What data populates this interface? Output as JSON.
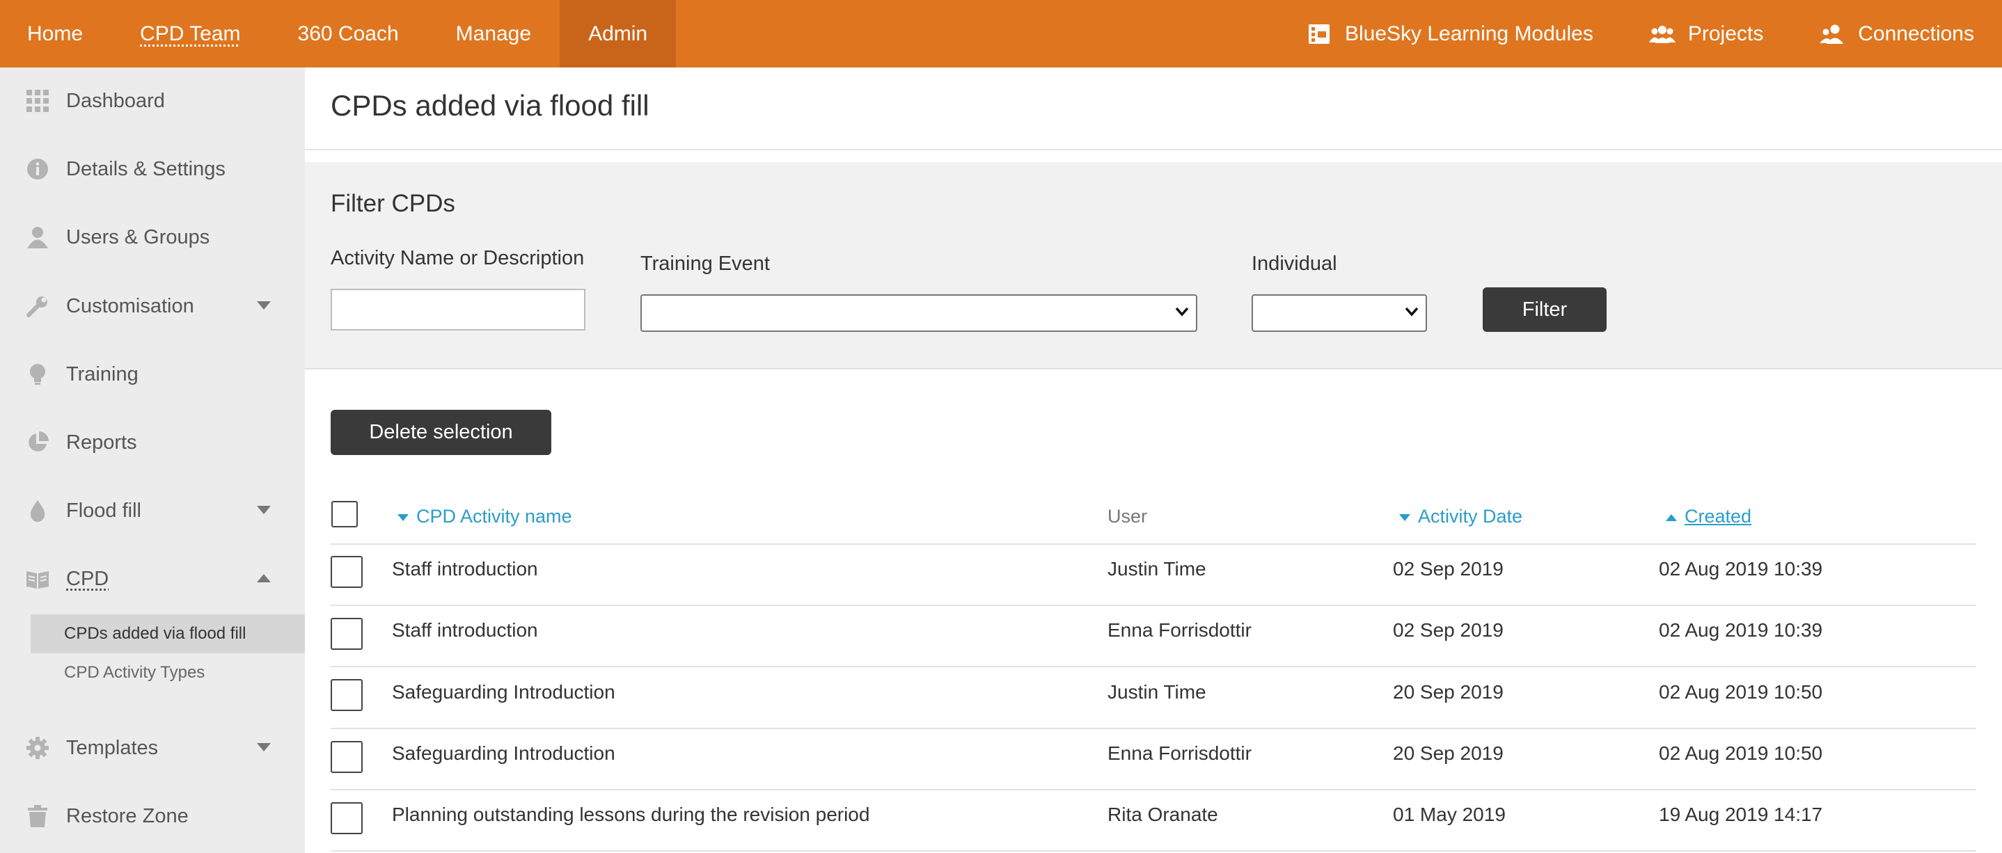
{
  "topnav": {
    "items": [
      "Home",
      "CPD Team",
      "360 Coach",
      "Manage",
      "Admin"
    ],
    "active": "Admin",
    "right_items": [
      "BlueSky Learning Modules",
      "Projects",
      "Connections"
    ],
    "accent_color": "#df761f"
  },
  "sidebar": {
    "items": [
      {
        "label": "Dashboard",
        "icon": "grid-icon"
      },
      {
        "label": "Details & Settings",
        "icon": "info-icon"
      },
      {
        "label": "Users & Groups",
        "icon": "user-icon"
      },
      {
        "label": "Customisation",
        "icon": "wrench-icon",
        "expandable": true
      },
      {
        "label": "Training",
        "icon": "lightbulb-icon"
      },
      {
        "label": "Reports",
        "icon": "pie-chart-icon"
      },
      {
        "label": "Flood fill",
        "icon": "drop-icon",
        "expandable": true
      },
      {
        "label": "CPD",
        "icon": "book-icon",
        "expanded": true
      },
      {
        "label": "Templates",
        "icon": "gear-icon",
        "expandable": true
      },
      {
        "label": "Restore Zone",
        "icon": "trash-icon"
      }
    ],
    "sub_items": [
      "CPDs added via flood fill",
      "CPD Activity Types"
    ],
    "active_sub": "CPDs added via flood fill"
  },
  "page": {
    "title": "CPDs added via flood fill"
  },
  "filter": {
    "title": "Filter CPDs",
    "activity_label": "Activity Name or Description",
    "activity_value": "",
    "training_label": "Training Event",
    "training_value": "",
    "individual_label": "Individual",
    "individual_value": "",
    "button": "Filter"
  },
  "actions": {
    "delete_button": "Delete selection"
  },
  "table": {
    "columns": [
      "CPD Activity name",
      "User",
      "Activity Date",
      "Created"
    ],
    "sort": {
      "CPD Activity name": "desc",
      "Activity Date": "desc",
      "Created": "asc"
    },
    "rows": [
      {
        "name": "Staff introduction",
        "user": "Justin Time",
        "date": "02 Sep 2019",
        "created": "02 Aug 2019 10:39"
      },
      {
        "name": "Staff introduction",
        "user": "Enna Forrisdottir",
        "date": "02 Sep 2019",
        "created": "02 Aug 2019 10:39"
      },
      {
        "name": "Safeguarding Introduction",
        "user": "Justin Time",
        "date": "20 Sep 2019",
        "created": "02 Aug 2019 10:50"
      },
      {
        "name": "Safeguarding Introduction",
        "user": "Enna Forrisdottir",
        "date": "20 Sep 2019",
        "created": "02 Aug 2019 10:50"
      },
      {
        "name": "Planning outstanding lessons during the revision period",
        "user": "Rita Oranate",
        "date": "01 May 2019",
        "created": "19 Aug 2019 14:17"
      }
    ]
  }
}
